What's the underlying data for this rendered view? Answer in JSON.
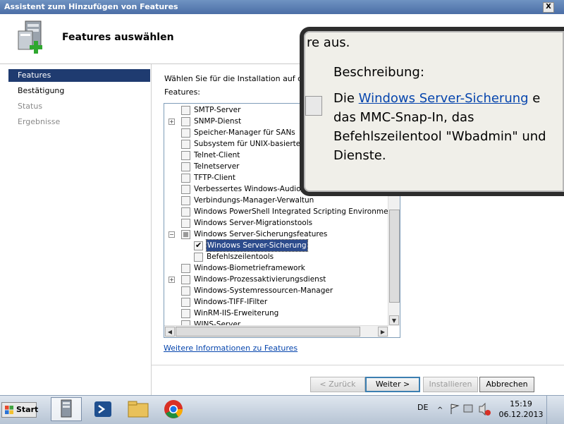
{
  "window": {
    "title": "Assistent zum Hinzufügen von Features",
    "close_label": "X"
  },
  "header": {
    "title": "Features auswählen"
  },
  "nav": [
    {
      "label": "Features",
      "state": "active"
    },
    {
      "label": "Bestätigung",
      "state": "normal"
    },
    {
      "label": "Status",
      "state": "disabled"
    },
    {
      "label": "Ergebnisse",
      "state": "disabled"
    }
  ],
  "content": {
    "instruction": "Wählen Sie für die Installation auf dem",
    "features_label": "Features:",
    "more_link": "Weitere Informationen zu Features"
  },
  "features": [
    {
      "label": "SMTP-Server",
      "level": 0,
      "expander": "",
      "check": "none"
    },
    {
      "label": "SNMP-Dienst",
      "level": 0,
      "expander": "+",
      "check": "none"
    },
    {
      "label": "Speicher-Manager für SANs",
      "level": 0,
      "expander": "",
      "check": "none"
    },
    {
      "label": "Subsystem für UNIX-basierte A",
      "level": 0,
      "expander": "",
      "check": "none"
    },
    {
      "label": "Telnet-Client",
      "level": 0,
      "expander": "",
      "check": "none"
    },
    {
      "label": "Telnetserver",
      "level": 0,
      "expander": "",
      "check": "none"
    },
    {
      "label": "TFTP-Client",
      "level": 0,
      "expander": "",
      "check": "none"
    },
    {
      "label": "Verbessertes Windows-Audio/V",
      "level": 0,
      "expander": "",
      "check": "none"
    },
    {
      "label": "Verbindungs-Manager-Verwaltun",
      "level": 0,
      "expander": "",
      "check": "none"
    },
    {
      "label": "Windows PowerShell Integrated Scripting Environment (IS",
      "level": 0,
      "expander": "",
      "check": "none"
    },
    {
      "label": "Windows Server-Migrationstools",
      "level": 0,
      "expander": "",
      "check": "none"
    },
    {
      "label": "Windows Server-Sicherungsfeatures",
      "level": 0,
      "expander": "−",
      "check": "partial"
    },
    {
      "label": "Windows Server-Sicherung",
      "level": 1,
      "expander": "",
      "check": "checked",
      "selected": true
    },
    {
      "label": "Befehlszeilentools",
      "level": 1,
      "expander": "",
      "check": "none"
    },
    {
      "label": "Windows-Biometrieframework",
      "level": 0,
      "expander": "",
      "check": "none"
    },
    {
      "label": "Windows-Prozessaktivierungsdienst",
      "level": 0,
      "expander": "+",
      "check": "none"
    },
    {
      "label": "Windows-Systemressourcen-Manager",
      "level": 0,
      "expander": "",
      "check": "none"
    },
    {
      "label": "Windows-TIFF-IFilter",
      "level": 0,
      "expander": "",
      "check": "none"
    },
    {
      "label": "WinRM-IIS-Erweiterung",
      "level": 0,
      "expander": "",
      "check": "none"
    },
    {
      "label": "WINS-Server",
      "level": 0,
      "expander": "",
      "check": "none"
    }
  ],
  "magnifier": {
    "top_text": "re aus.",
    "heading": "Beschreibung:",
    "body_prefix": "Die ",
    "body_link": "Windows Server-Sicherung",
    "body_line1_suffix": " e",
    "body_line2": "das MMC-Snap-In, das",
    "body_line3": "Befehlszeilentool \"Wbadmin\" und",
    "body_line4": "Dienste."
  },
  "buttons": {
    "back": "< Zurück",
    "next": "Weiter >",
    "install": "Installieren",
    "cancel": "Abbrechen"
  },
  "taskbar": {
    "start": "Start",
    "language": "DE",
    "time": "15:19",
    "date": "06.12.2013"
  },
  "colors": {
    "nav_active": "#1f3b70",
    "selection": "#2c4b8c",
    "link": "#0645ad"
  }
}
